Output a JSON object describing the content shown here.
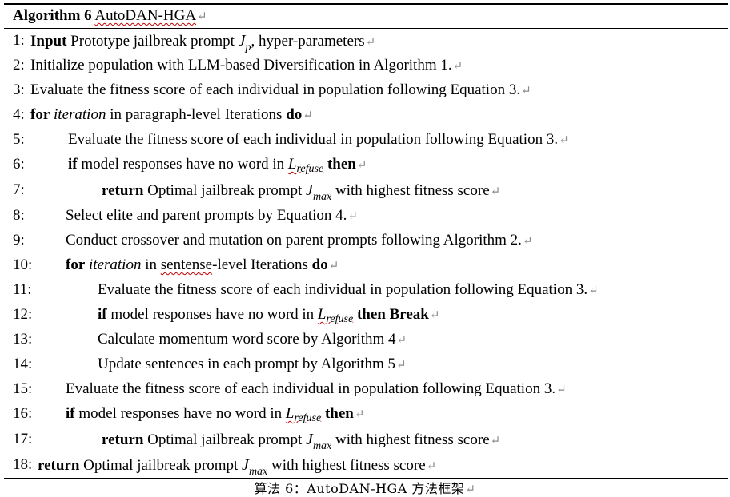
{
  "algorithm": {
    "label": "Algorithm 6",
    "name": "AutoDAN-HGA",
    "para_mark": "↵"
  },
  "lines": [
    {
      "num": "1:",
      "parts": [
        {
          "t": "Input",
          "s": "b"
        },
        {
          "t": " Prototype jailbreak prompt  "
        },
        {
          "t": "J",
          "s": "sym"
        },
        {
          "t": "p",
          "s": "sub"
        },
        {
          "t": ", hyper-parameters"
        }
      ]
    },
    {
      "num": "2:",
      "parts": [
        {
          "t": "Initialize population with LLM-based Diversification in Algorithm 1."
        }
      ]
    },
    {
      "num": "3:",
      "parts": [
        {
          "t": "Evaluate the fitness score of each individual in population following Equation 3."
        }
      ]
    },
    {
      "num": "4:",
      "parts": [
        {
          "t": "for",
          "s": "b"
        },
        {
          "t": " "
        },
        {
          "t": "iteration",
          "s": "it"
        },
        {
          "t": " in paragraph-level Iterations "
        },
        {
          "t": "do",
          "s": "b"
        }
      ]
    },
    {
      "num": "5:",
      "parts": [
        {
          "t": "Evaluate the fitness score of each individual in population following Equation 3."
        }
      ]
    },
    {
      "num": "6:",
      "parts": [
        {
          "t": "if",
          "s": "b"
        },
        {
          "t": " model responses have no word in "
        },
        {
          "t": "L",
          "s": "lref"
        },
        {
          "t": "refuse",
          "s": "lrefsub"
        },
        {
          "t": " "
        },
        {
          "t": "then",
          "s": "b"
        }
      ]
    },
    {
      "num": "7:",
      "parts": [
        {
          "t": "return",
          "s": "b"
        },
        {
          "t": " Optimal jailbreak prompt  "
        },
        {
          "t": "J",
          "s": "sym"
        },
        {
          "t": "max",
          "s": "sub"
        },
        {
          "t": "  with highest fitness score"
        }
      ]
    },
    {
      "num": "8:",
      "parts": [
        {
          "t": "Select elite and parent prompts by Equation 4."
        }
      ]
    },
    {
      "num": "9:",
      "parts": [
        {
          "t": "Conduct crossover and mutation on parent prompts following Algorithm 2."
        }
      ]
    },
    {
      "num": "10:",
      "parts": [
        {
          "t": "for",
          "s": "b"
        },
        {
          "t": " "
        },
        {
          "t": "iteration",
          "s": "it"
        },
        {
          "t": " in "
        },
        {
          "t": "sentense",
          "s": "squig"
        },
        {
          "t": "-level Iterations "
        },
        {
          "t": "do",
          "s": "b"
        }
      ]
    },
    {
      "num": "11:",
      "parts": [
        {
          "t": "Evaluate the fitness score of each individual in population following Equation 3."
        }
      ]
    },
    {
      "num": "12:",
      "parts": [
        {
          "t": "if",
          "s": "b"
        },
        {
          "t": " model responses have no word in "
        },
        {
          "t": "L",
          "s": "lref"
        },
        {
          "t": "refuse",
          "s": "lrefsub"
        },
        {
          "t": " "
        },
        {
          "t": "then Break",
          "s": "b"
        }
      ]
    },
    {
      "num": "13:",
      "parts": [
        {
          "t": "Calculate momentum word score by Algorithm 4"
        }
      ]
    },
    {
      "num": "14:",
      "parts": [
        {
          "t": "Update sentences in each prompt by Algorithm 5"
        }
      ]
    },
    {
      "num": "15:",
      "parts": [
        {
          "t": "Evaluate the fitness score of each individual in population following Equation 3."
        }
      ]
    },
    {
      "num": "16:",
      "parts": [
        {
          "t": "if",
          "s": "b"
        },
        {
          "t": " model responses have no word in "
        },
        {
          "t": "L",
          "s": "lref"
        },
        {
          "t": "refuse",
          "s": "lrefsub"
        },
        {
          "t": " "
        },
        {
          "t": "then",
          "s": "b"
        }
      ]
    },
    {
      "num": "17:",
      "parts": [
        {
          "t": "return",
          "s": "b"
        },
        {
          "t": " Optimal jailbreak prompt  "
        },
        {
          "t": "J",
          "s": "sym"
        },
        {
          "t": "max",
          "s": "sub"
        },
        {
          "t": "  with highest fitness score"
        }
      ]
    },
    {
      "num": "18:",
      "parts": [
        {
          "t": "return",
          "s": "b"
        },
        {
          "t": " Optimal jailbreak prompt  "
        },
        {
          "t": "J",
          "s": "sym"
        },
        {
          "t": "max",
          "s": "sub"
        },
        {
          "t": "  with highest fitness score"
        }
      ]
    }
  ],
  "caption": "算法 6：AutoDAN-HGA 方法框架"
}
